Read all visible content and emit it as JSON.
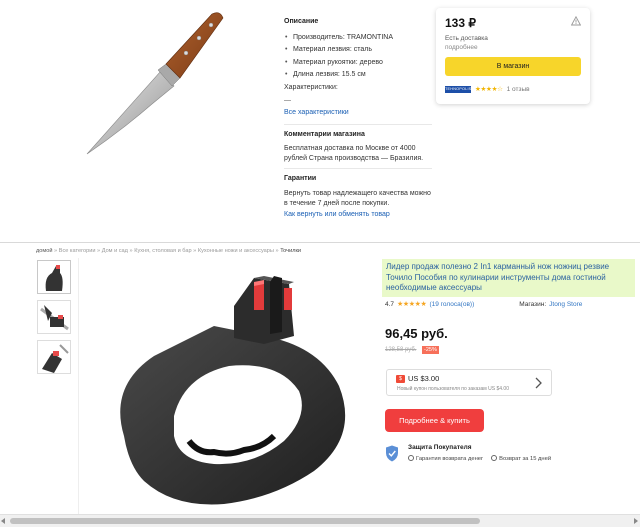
{
  "market": {
    "description_title": "Описание",
    "specs": [
      "Производитель: TRAMONTINA",
      "Материал лезвия: сталь",
      "Материал рукоятки: дерево",
      "Длина лезвия: 15.5 см"
    ],
    "characteristics_label": "Характеристики:",
    "characteristics_dash": "—",
    "all_characteristics_link": "Все характеристики",
    "shop_comment_title": "Комментарии магазина",
    "shop_comment_text": "Бесплатная доставка по Москве от 4000 рублей Страна производства — Бразилия.",
    "guarantee_title": "Гарантии",
    "guarantee_text": "Вернуть товар надлежащего качества можно в течение 7 дней после покупки.",
    "guarantee_link": "Как вернуть или обменять товар",
    "offer": {
      "price": "133 ₽",
      "delivery": "Есть доставка",
      "more": "подробнее",
      "button": "В магазин",
      "shop_logo_text": "TEHNOPOLIS",
      "stars": "★★★★☆",
      "reviews": "1 отзыв",
      "rating_stars": 4
    }
  },
  "ali": {
    "breadcrumb": {
      "home": "домой",
      "items": [
        "Все категории",
        "Дом и сад",
        "Кухня, столовая и бар",
        "Кухонные ножи и аксессуары"
      ],
      "current": "Точилки",
      "separator": "»"
    },
    "title": "Лидер продаж полезно 2 In1 карманный нож ножниц резвие Точило Пособия по кулинарии инструменты дома гостиной необходимые аксессуары",
    "rating_value": "4.7",
    "rating_stars": "★★★★★",
    "reviews": "(19 голоса(ов))",
    "store_label": "Магазин:",
    "store_name": "Jtong Store",
    "price": "96,45 руб.",
    "old_price": "128,58 руб.",
    "discount": "-25%",
    "coupon": {
      "tag": "$",
      "amount": "US $3.00",
      "note": "Новый купон пользователя по заказам US $4.00"
    },
    "buy_button": "Подробнее & купить",
    "protection_title": "Защита Покупателя",
    "protection_items": [
      "Гарантия возврата денег",
      "Возврат за 15 дней"
    ]
  },
  "colors": {
    "yellow_button": "#f7d52a",
    "red_button": "#f03e3e",
    "title_highlight": "#e9f9c9",
    "link_blue": "#1a5fb4"
  },
  "icons": [
    "warning-icon",
    "chevron-right-icon",
    "shield-icon",
    "check-circle-icon",
    "star-icon"
  ]
}
